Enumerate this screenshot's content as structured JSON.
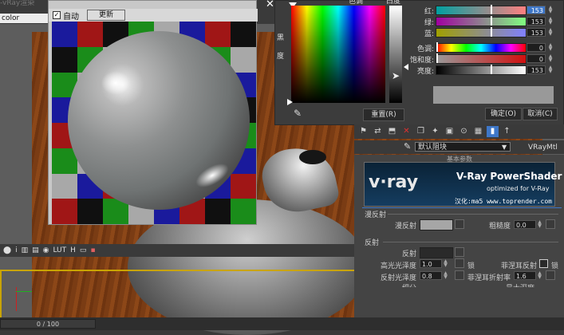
{
  "app": {
    "title_fragment": "-vRay渲染",
    "viewport_label": "color"
  },
  "vfb": {
    "auto_label": "自动",
    "update_label": "更新",
    "checker_colors": [
      "#1a1a9c",
      "#1a8c1a",
      "#a01616",
      "#a8a8a8",
      "#101010"
    ]
  },
  "picker": {
    "hue_label": "色调",
    "white_label": "白度",
    "black_label_1": "黑",
    "black_label_2": "度",
    "reset_label": "重置(R)",
    "ok_label": "确定(O)",
    "cancel_label": "取消(C)",
    "red_label": "红:",
    "green_label": "绿:",
    "blue_label": "蓝:",
    "hue_slider_label": "色调:",
    "sat_label": "饱和度:",
    "val_label": "亮度:",
    "red": "153",
    "green": "153",
    "blue": "153",
    "hue": "0",
    "sat": "0",
    "val": "153",
    "swatch_color": "#999999"
  },
  "material": {
    "name": "默认阻块",
    "type": "VRayMtl",
    "panel_title_fragment": "基本参数"
  },
  "banner": {
    "logo": "v·ray",
    "title": "V-Ray PowerShader",
    "subtitle": "optimized for V-Ray",
    "credit": "汉化:ma5 www.toprender.com"
  },
  "diffuse": {
    "section": "漫反射",
    "diffuse_label": "漫反射",
    "roughness_label": "粗糙度",
    "roughness": "0.0"
  },
  "reflection": {
    "section": "反射",
    "reflect_label": "反射",
    "hilight_gloss_label": "高光光泽度",
    "hilight_gloss": "1.0",
    "refl_gloss_label": "反射光泽度",
    "refl_gloss": "0.8",
    "subdivs_label": "细分",
    "lock_label": "锁",
    "fresnel_label": "菲涅耳反射",
    "fresnel_ior_label": "菲涅耳折射率",
    "fresnel_ior": "1.6",
    "max_depth_label": "最大深度"
  },
  "status": {
    "icons": [
      "i",
      "LUT",
      "H"
    ],
    "timeline": "0 / 100"
  }
}
